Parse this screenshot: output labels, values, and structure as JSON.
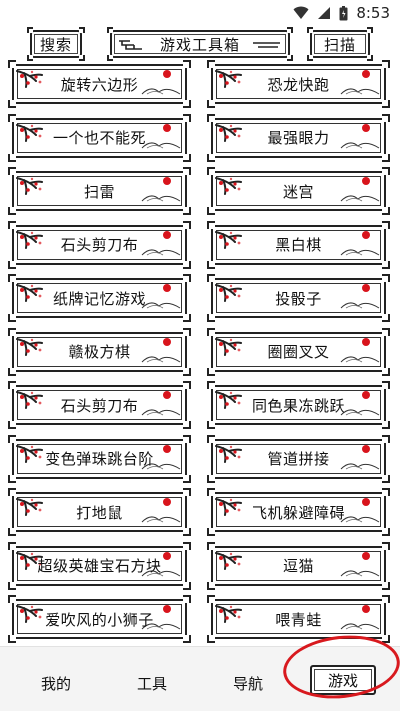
{
  "status_bar": {
    "time": "8:53"
  },
  "top_bar": {
    "search_label": "搜索",
    "title": "游戏工具箱",
    "scan_label": "扫描"
  },
  "games": [
    "旋转六边形",
    "恐龙快跑",
    "一个也不能死",
    "最强眼力",
    "扫雷",
    "迷宫",
    "石头剪刀布",
    "黑白棋",
    "纸牌记忆游戏",
    "投骰子",
    "赣极方棋",
    "圈圈叉叉",
    "石头剪刀布",
    "同色果冻跳跃",
    "变色弹珠跳台阶",
    "管道拼接",
    "打地鼠",
    "飞机躲避障碍",
    "超级英雄宝石方块",
    "逗猫",
    "爱吹风的小狮子",
    "喂青蛙"
  ],
  "bottom_nav": {
    "me": "我的",
    "tools": "工具",
    "guide": "导航",
    "games": "游戏"
  },
  "colors": {
    "accent_red": "#d8141c",
    "frame": "#222222"
  }
}
